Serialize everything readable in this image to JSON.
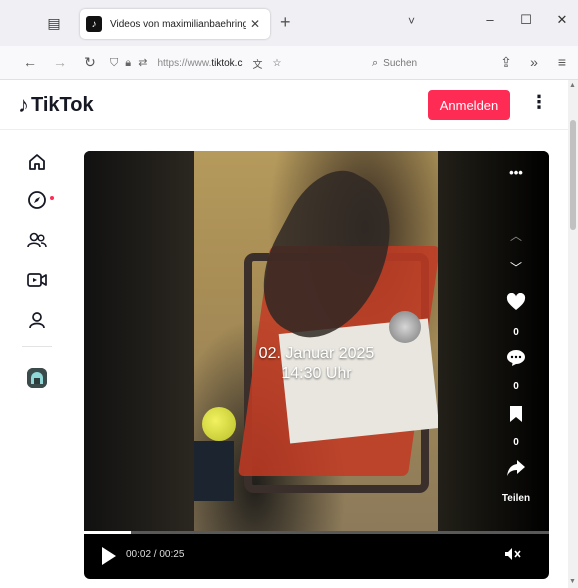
{
  "browser": {
    "tab_title": "Videos von maximilianbaehring",
    "tab_favicon": "tiktok-icon",
    "new_tab": "+",
    "tab_overflow": "˅",
    "window_minimize": "–",
    "window_maximize": "☐",
    "window_close": "✕",
    "url_host": "https://www.",
    "url_domain": "tiktok.c",
    "search_placeholder": "Suchen"
  },
  "header": {
    "logo_text": "TikTok",
    "login_label": "Anmelden",
    "more_label": "⋮"
  },
  "sidebar": {
    "items": [
      {
        "icon": "home-icon"
      },
      {
        "icon": "explore-icon"
      },
      {
        "icon": "following-icon"
      },
      {
        "icon": "live-icon"
      },
      {
        "icon": "profile-icon"
      }
    ],
    "live_creator_icon": "live-avatar-icon"
  },
  "video": {
    "overlay_date": "02. Januar 2025",
    "overlay_time": "14:30 Uhr",
    "more_menu": "•••",
    "likes": "0",
    "comments": "0",
    "saves": "0",
    "share_label": "Teilen",
    "time_display": "00:02 / 00:25",
    "progress": 0.1
  },
  "colors": {
    "accent": "#fe2c55",
    "video_bg": "#000000"
  }
}
